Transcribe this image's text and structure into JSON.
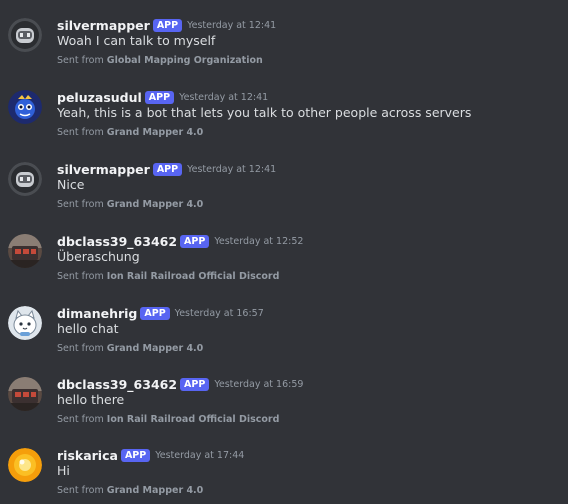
{
  "badge_label": "APP",
  "sent_from_prefix": "Sent from",
  "messages": [
    {
      "username": "silvermapper",
      "timestamp": "Yesterday at 12:41",
      "text": "Woah I can talk to myself",
      "server": "Global Mapping Organization",
      "avatar": "robot-head-icon"
    },
    {
      "username": "peluzasudul",
      "timestamp": "Yesterday at 12:41",
      "text": "Yeah, this is a bot that lets you talk to other people across servers",
      "server": "Grand Mapper 4.0",
      "avatar": "blue-character-icon"
    },
    {
      "username": "silvermapper",
      "timestamp": "Yesterday at 12:41",
      "text": "Nice",
      "server": "Grand Mapper 4.0",
      "avatar": "robot-head-icon"
    },
    {
      "username": "dbclass39_63462",
      "timestamp": "Yesterday at 12:52",
      "text": "Überaschung",
      "server": "Ion Rail Railroad Official Discord",
      "avatar": "train-photo-icon"
    },
    {
      "username": "dimanehrig",
      "timestamp": "Yesterday at 16:57",
      "text": "hello chat",
      "server": "Grand Mapper 4.0",
      "avatar": "cat-icon"
    },
    {
      "username": "dbclass39_63462",
      "timestamp": "Yesterday at 16:59",
      "text": "hello there",
      "server": "Ion Rail Railroad Official Discord",
      "avatar": "train-photo-icon"
    },
    {
      "username": "riskarica",
      "timestamp": "Yesterday at 17:44",
      "text": "Hi",
      "server": "Grand Mapper 4.0",
      "avatar": "orange-orb-icon"
    }
  ]
}
